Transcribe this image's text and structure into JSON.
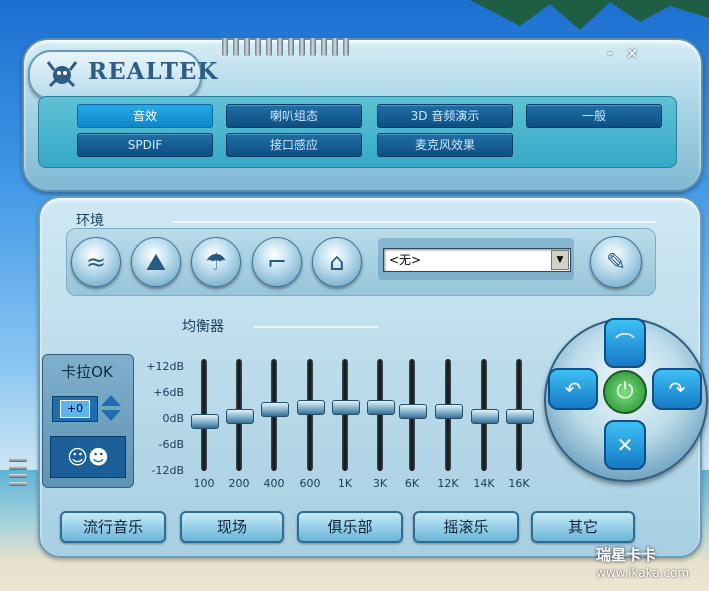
{
  "app": {
    "logo_text": "REALTEK",
    "minimize_label": "-",
    "close_label": "×"
  },
  "tabs": [
    {
      "label": "音效",
      "active": true
    },
    {
      "label": "喇叭组态",
      "active": false
    },
    {
      "label": "3D 音频演示",
      "active": false
    },
    {
      "label": "一般",
      "active": false
    },
    {
      "label": "SPDIF",
      "active": false
    },
    {
      "label": "接口感应",
      "active": false
    },
    {
      "label": "麦克风效果",
      "active": false
    }
  ],
  "environment": {
    "title": "环境",
    "buttons": [
      "underwater-icon",
      "opera-house-icon",
      "shower-icon",
      "pipe-icon",
      "colosseum-icon"
    ],
    "select_value": "<无>",
    "edit_icon": "edit-icon"
  },
  "equalizer": {
    "title": "均衡器",
    "db_labels": [
      "+12dB",
      "+6dB",
      "0dB",
      "-6dB",
      "-12dB"
    ],
    "bands": [
      "100",
      "200",
      "400",
      "600",
      "1K",
      "3K",
      "6K",
      "12K",
      "14K",
      "16K"
    ],
    "levels_db": [
      -1,
      0,
      1.5,
      2,
      2,
      2,
      1,
      1,
      0,
      0
    ]
  },
  "karaoke": {
    "title": "卡拉OK",
    "value": "+0",
    "icon": "karaoke-icon"
  },
  "presets": [
    "流行音乐",
    "现场",
    "俱乐部",
    "摇滚乐",
    "其它"
  ],
  "watermark": {
    "text": "www.ikaka.com",
    "logo": "瑞星卡卡"
  },
  "colors": {
    "accent": "#25a9e8",
    "tab": "#1f6fa6",
    "power": "#1f8a2e"
  }
}
